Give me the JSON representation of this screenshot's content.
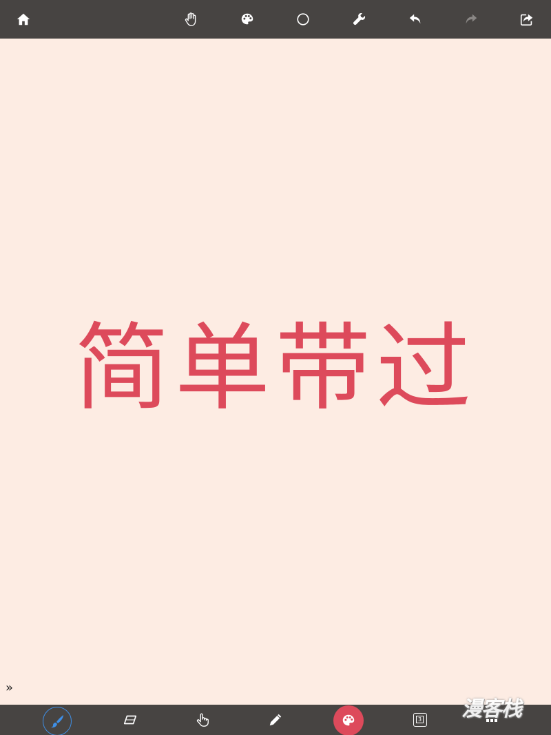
{
  "toolbar_top": {
    "icons": [
      "home-icon",
      "hand-icon",
      "palette-icon",
      "circle-icon",
      "wrench-icon",
      "undo-icon",
      "redo-icon",
      "share-icon"
    ]
  },
  "canvas": {
    "text": "简单带过",
    "text_color": "#dd4a5b",
    "background_color": "#fdece3",
    "expand_label": "»"
  },
  "toolbar_bottom": {
    "icons": [
      "brush-icon",
      "eraser-icon",
      "hand-icon",
      "pencil-icon",
      "palette-icon",
      "layers-icon",
      "more-icon"
    ],
    "layer_count": "3",
    "current_color": "#dd4a5b",
    "active_tool_color": "#3f8fe6"
  },
  "watermark": {
    "text": "漫客栈"
  },
  "colors": {
    "toolbar_bg": "#474442"
  }
}
